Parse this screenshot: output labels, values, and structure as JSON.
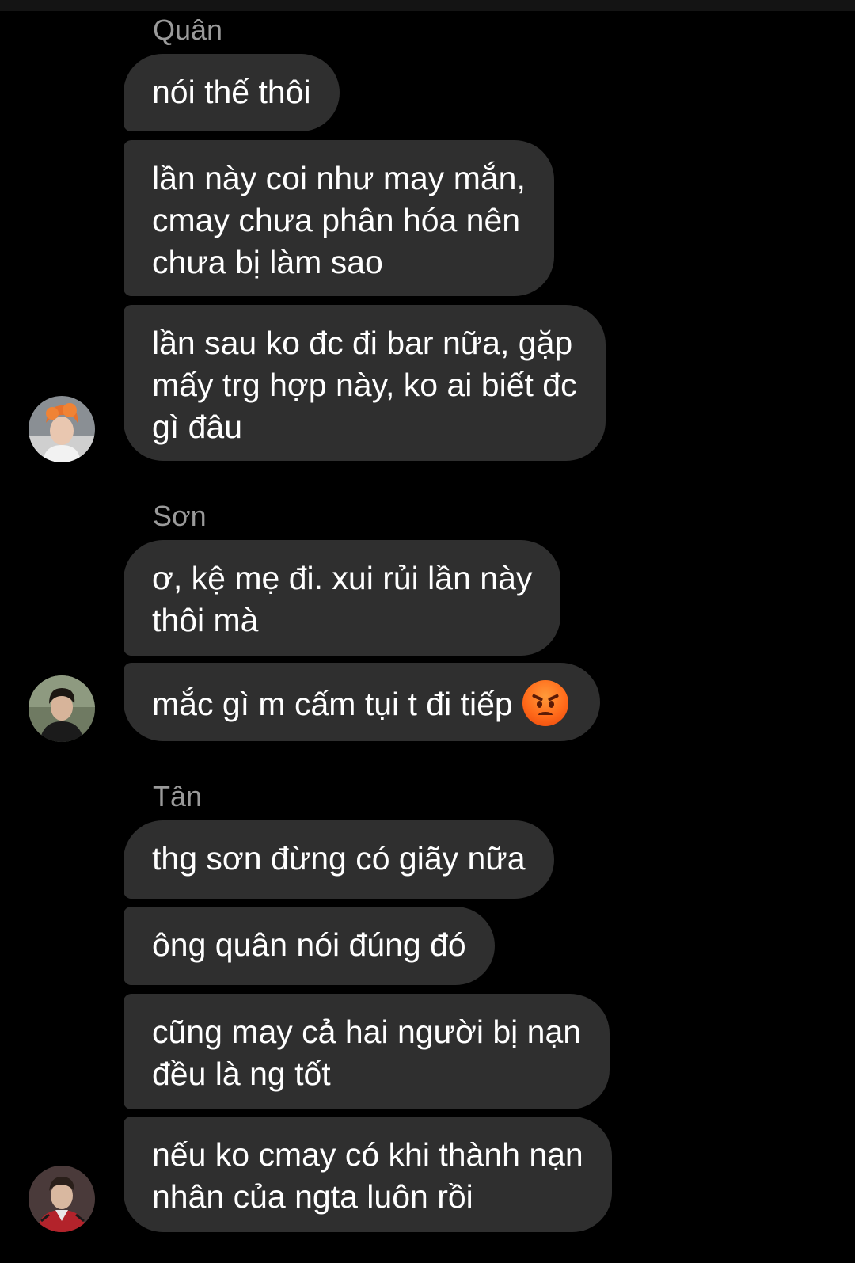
{
  "colors": {
    "background": "#000000",
    "bubble": "#2f2f2f",
    "sender_name": "#9a9a9a",
    "message_text": "#ffffff"
  },
  "groups": [
    {
      "sender": "Quân",
      "avatar_icon": "user-avatar-orange-hair",
      "messages": [
        "nói thế thôi",
        "lần này coi như may mắn,\ncmay chưa phân hóa nên\nchưa bị làm sao",
        "lần sau ko đc đi bar nữa, gặp\nmấy trg hợp này, ko ai biết đc\ngì đâu"
      ]
    },
    {
      "sender": "Sơn",
      "avatar_icon": "user-avatar-dark-hair",
      "messages": [
        "ơ, kệ mẹ đi. xui rủi lần này\nthôi mà",
        "mắc gì m cấm tụi t đi tiếp"
      ],
      "emoji_icon": "angry-face-icon"
    },
    {
      "sender": "Tân",
      "avatar_icon": "user-avatar-red-jacket",
      "messages": [
        "thg sơn đừng có giãy nữa",
        "ông quân nói đúng đó",
        "cũng may cả hai người bị nạn\nđều là ng tốt",
        "nếu ko cmay có khi thành nạn\nnhân của ngta luôn rồi"
      ]
    }
  ]
}
